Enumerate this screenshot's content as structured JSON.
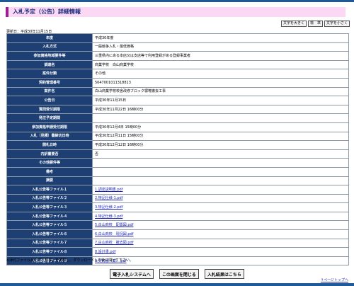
{
  "title": "入札予定（公告）詳細情報",
  "size_buttons": {
    "large": "文字を大きく",
    "standard": "標　準",
    "small": "文字を小さく"
  },
  "update_date": "更新日：平成30年11月15日",
  "rows": [
    {
      "label": "年度",
      "value": "平成30年度"
    },
    {
      "label": "入札方式",
      "value": "一般競争入札・最低価格"
    },
    {
      "label": "参加資格地域要件等",
      "value": "三重県内にある本店又は支店等で利用登録がある登録事業者"
    },
    {
      "label": "調達名",
      "value": "商業学校　白山商業学校"
    },
    {
      "label": "案件分類",
      "value": "その他"
    },
    {
      "label": "契約管理番号",
      "value": "5047001011318813"
    },
    {
      "label": "案件名",
      "value": "白山商業学校校舎改修ブロック塀等撤去工事"
    },
    {
      "label": "公告日",
      "value": "平成30年11月15日"
    },
    {
      "label": "質問受付期限",
      "value": "平成30年11月22日 16時00分"
    },
    {
      "label": "発注予定期間",
      "value": ""
    },
    {
      "label": "参加資格申請受付期限",
      "value": "平成30年12月4日 15時00分"
    },
    {
      "label": "入札（見積）書締切日時",
      "value": "平成30年12月11日 15時00分"
    },
    {
      "label": "開札日時",
      "value": "平成30年12月12日 16時00分"
    },
    {
      "label": "内訳書要否",
      "value": "否"
    },
    {
      "label": "その他要件等",
      "value": ""
    },
    {
      "label": "備考",
      "value": ""
    },
    {
      "label": "摘要",
      "value": ""
    }
  ],
  "files": [
    {
      "label": "入札公告等ファイル１",
      "link": "1.調達説明書.pdf"
    },
    {
      "label": "入札公告等ファイル２",
      "link": "2.特記仕様-1.pdf"
    },
    {
      "label": "入札公告等ファイル３",
      "link": "3.特記仕様-2.pdf"
    },
    {
      "label": "入札公告等ファイル４",
      "link": "4.特記仕様-3.pdf"
    },
    {
      "label": "入札公告等ファイル５",
      "link": "5.白山商校　配置図.pdf"
    },
    {
      "label": "入札公告等ファイル６",
      "link": "6.白山商校　現況図.pdf"
    },
    {
      "label": "入札公告等ファイル７",
      "link": "7.白山商校　撤去図.pdf"
    },
    {
      "label": "入札公告等ファイル８",
      "link": "8.設計書.pdf"
    },
    {
      "label": "入札公告等ファイル９",
      "link": "9.契約書（案）.pdf"
    }
  ],
  "note": "※添付ファイルは必ず「保存」を選択し、ダウンロードした後に開いて下さい。",
  "buttons": {
    "system": "電子入札システムへ",
    "close": "この画面を閉じる",
    "results": "入札結果はこちら"
  },
  "page_top": "↑ページトップへ"
}
